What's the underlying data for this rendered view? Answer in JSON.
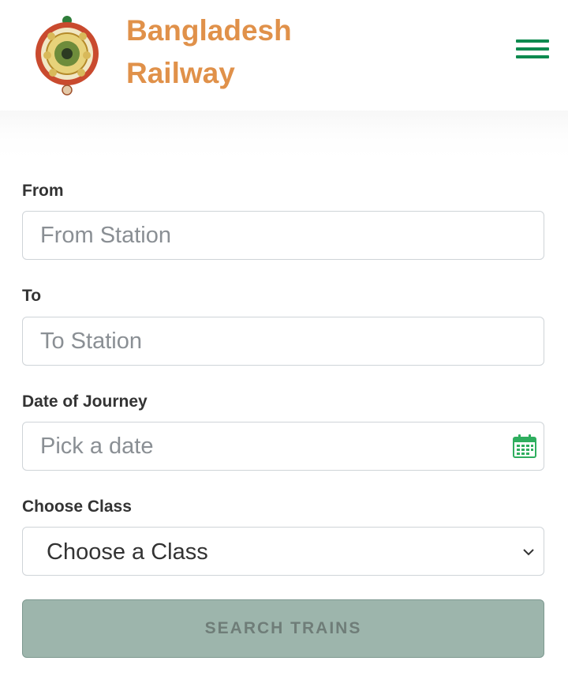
{
  "header": {
    "brand_line1": "Bangladesh",
    "brand_line2": "Railway",
    "logo_icon": "bangladesh-railway-emblem",
    "menu_icon": "hamburger-menu-icon",
    "brand_color": "#e0914a",
    "accent_color": "#0d8a4f"
  },
  "form": {
    "from": {
      "label": "From",
      "placeholder": "From Station",
      "value": ""
    },
    "to": {
      "label": "To",
      "placeholder": "To Station",
      "value": ""
    },
    "date": {
      "label": "Date of Journey",
      "placeholder": "Pick a date",
      "value": "",
      "icon": "calendar-icon"
    },
    "class": {
      "label": "Choose Class",
      "selected": "Choose a Class",
      "icon": "chevron-down-icon"
    },
    "submit_label": "SEARCH TRAINS"
  }
}
